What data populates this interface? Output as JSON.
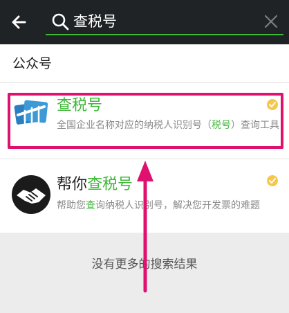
{
  "topbar": {
    "back_icon": "arrow-left-icon",
    "search_icon": "search-icon",
    "search_value": "查税号",
    "clear_icon": "close-icon",
    "accent_color": "#3fb83a"
  },
  "section": {
    "title": "公众号"
  },
  "results": [
    {
      "title": "查税号",
      "desc_before": "全国企业名称对应的纳税人识别号（",
      "desc_highlight": "税号",
      "desc_after": "）查询工具",
      "avatar_icon": "tax-logo-icon",
      "verified_icon": "verified-check-icon"
    },
    {
      "title_prefix": "帮你",
      "title_highlight": "查税号",
      "desc_before": "帮助您",
      "desc_highlight": "查",
      "desc_after": "询纳税人识别号，解决您开发票的难题",
      "avatar_icon": "handshake-icon",
      "verified_icon": "verified-check-icon"
    }
  ],
  "footer": {
    "no_more_text": "没有更多的搜索结果"
  },
  "annotation": {
    "box_color": "#e0106e"
  }
}
